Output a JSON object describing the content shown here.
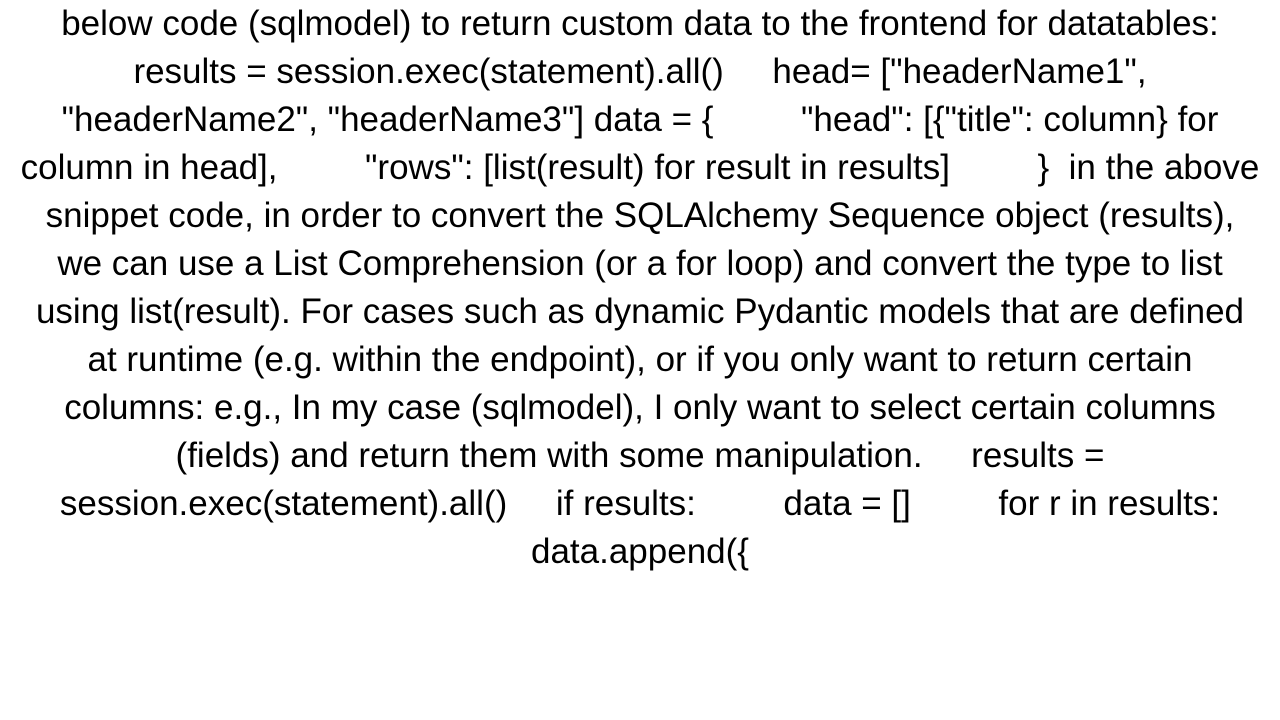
{
  "document": {
    "body_text": "below code (sqlmodel) to return custom data to the frontend for datatables: results = session.exec(statement).all()     head= [\"headerName1\", \"headerName2\", \"headerName3\"] data = {         \"head\": [{\"title\": column} for column in head],         \"rows\": [list(result) for result in results]         }  in the above snippet code, in order to convert the SQLAlchemy Sequence object (results), we can use a List Comprehension (or a for loop) and convert the type to list using list(result). For cases such as dynamic Pydantic models that are defined at runtime (e.g. within the endpoint), or if you only want to return certain columns: e.g., In my case (sqlmodel), I only want to select certain columns (fields) and return them with some manipulation.     results = session.exec(statement).all()     if results:         data = []         for r in results:             data.append({"
  }
}
